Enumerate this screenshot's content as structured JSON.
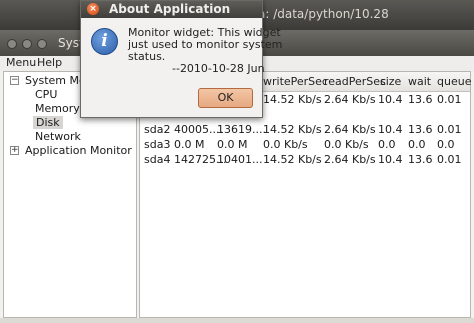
{
  "background_window": {
    "title_fragment": "a: /data/python/10.28"
  },
  "main_window": {
    "title_fragment": "Syst"
  },
  "menubar": {
    "items": [
      "Menu",
      "Help"
    ]
  },
  "tree": {
    "root1": "System Monit",
    "children": [
      "CPU",
      "Memory",
      "Disk",
      "Network"
    ],
    "root2": "Application Monitor",
    "selected": "Disk"
  },
  "disk_table": {
    "headers": [
      "writePerSec",
      "readPerSec",
      "size",
      "wait",
      "queue"
    ],
    "rows": [
      [
        "",
        "",
        "",
        "14.52 Kb/s",
        "2.64 Kb/s",
        "10.4",
        "13.6",
        "0.01"
      ],
      [
        "",
        "",
        "",
        "",
        "",
        "",
        "",
        ""
      ],
      [
        "sda2",
        "40005....",
        "13619....",
        "14.52 Kb/s",
        "2.64 Kb/s",
        "10.4",
        "13.6",
        "0.01"
      ],
      [
        "sda3",
        "0.0 M",
        "0.0 M",
        "0.0 Kb/s",
        "0.0 Kb/s",
        "0.0",
        "0.0",
        "0.0"
      ],
      [
        "sda4",
        "142725...",
        "10401...",
        "14.52 Kb/s",
        "2.64 Kb/s",
        "10.4",
        "13.6",
        "0.01"
      ]
    ]
  },
  "dialog": {
    "title": "About Application",
    "line1": "Monitor widget: This widget",
    "line2": "just used to monitor system",
    "line3": "status.",
    "line4": "--2010-10-28 Jun",
    "ok_label": "OK",
    "icon": "info-icon",
    "close_glyph": "×"
  },
  "colors": {
    "ok_button": "#e6a882",
    "dialog_close": "#d64a14",
    "info_icon": "#2c5ea8"
  }
}
